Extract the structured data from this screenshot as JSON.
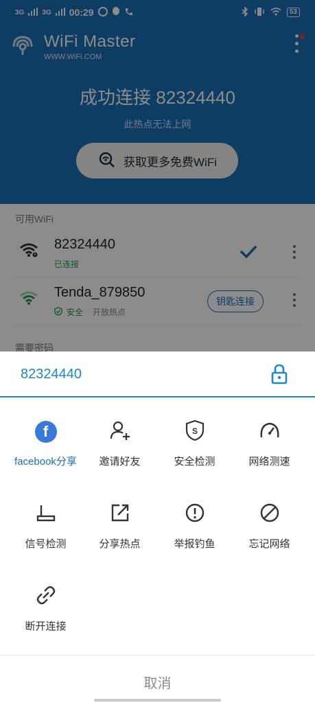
{
  "status_bar": {
    "time": "00:29",
    "sig1": "3G",
    "sig2": "3G",
    "battery": "53"
  },
  "app": {
    "title": "WiFi Master",
    "subtitle": "WWW.WiFi.COM"
  },
  "hero": {
    "title": "成功连接 82324440",
    "subtitle": "此热点无法上网",
    "button_label": "获取更多免费WiFi"
  },
  "list": {
    "section_available": "可用WiFi",
    "networks": [
      {
        "name": "82324440",
        "status": "已连接"
      },
      {
        "name": "Tenda_879850",
        "security": "安全",
        "note": "开放热点",
        "action": "钥匙连接"
      }
    ],
    "section_password": "需要密码"
  },
  "sheet": {
    "ssid": "82324440",
    "actions": [
      {
        "label": "facebook分享",
        "icon": "facebook-icon"
      },
      {
        "label": "邀请好友",
        "icon": "invite-friend-icon"
      },
      {
        "label": "安全检测",
        "icon": "shield-icon"
      },
      {
        "label": "网络测速",
        "icon": "speedometer-icon"
      },
      {
        "label": "信号检测",
        "icon": "router-icon"
      },
      {
        "label": "分享热点",
        "icon": "share-icon"
      },
      {
        "label": "举报钓鱼",
        "icon": "alert-icon"
      },
      {
        "label": "忘记网络",
        "icon": "forbidden-icon"
      },
      {
        "label": "断开连接",
        "icon": "unlink-icon"
      }
    ],
    "cancel": "取消"
  },
  "colors": {
    "brand": "#1b6fb6",
    "accent": "#1b88c9",
    "connected": "#1f9a4a"
  }
}
